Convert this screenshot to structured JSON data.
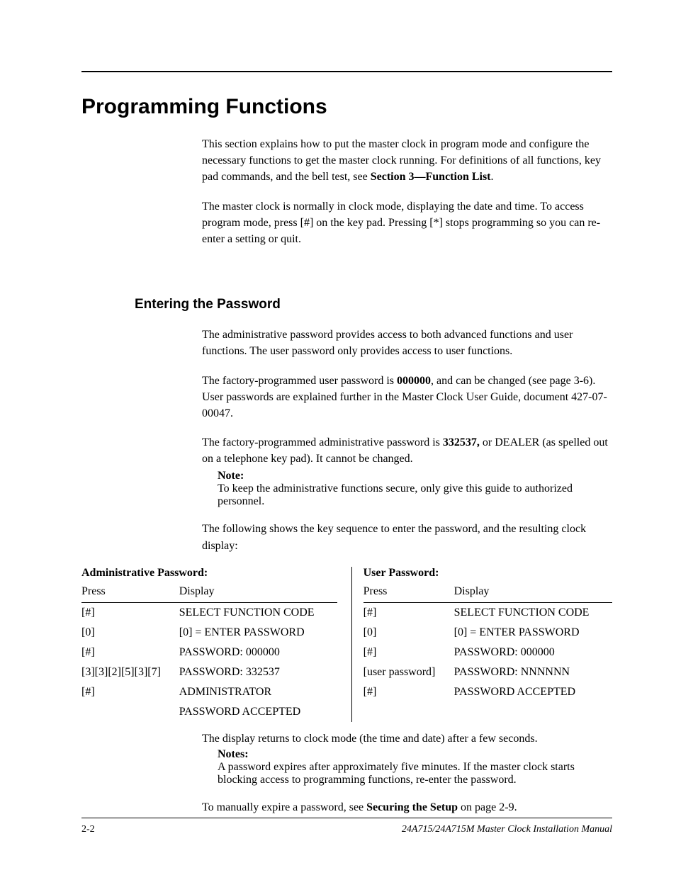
{
  "main_heading": "Programming Functions",
  "intro": {
    "p1a": "This section explains how to put the master clock in program mode and configure the necessary functions to get the master clock running. For definitions of all functions, key pad commands, and the bell test, see ",
    "p1bold": "Section 3—Function List",
    "p1b": ".",
    "p2": "The master clock is normally in clock mode, displaying the date and time. To access program mode, press [#] on the key pad. Pressing [*] stops programming so you can re-enter a setting or quit."
  },
  "sub_heading": "Entering the Password",
  "pw": {
    "p1": "The administrative password provides access to both advanced functions and user functions. The user password only provides access to user functions.",
    "p2a": "The factory-programmed user password is ",
    "p2bold": "000000",
    "p2b": ", and can be changed (see page 3-6). User passwords are explained further in the Master Clock User Guide, document 427-07-00047.",
    "p3a": "The factory-programmed administrative password is ",
    "p3bold": "332537,",
    "p3b": " or DEALER (as spelled out on a telephone key pad). It cannot be changed.",
    "note_label": "Note:",
    "note_text": "To keep the administrative functions secure, only give this guide to authorized personnel.",
    "p4": "The following shows the key sequence to enter the password, and the resulting clock display:"
  },
  "admin_title": "Administrative Password:",
  "user_title": "User Password:",
  "th_press": "Press",
  "th_display": "Display",
  "admin_rows": [
    {
      "press": "[#]",
      "disp": "SELECT FUNCTION CODE"
    },
    {
      "press": "[0]",
      "disp": "[0] = ENTER PASSWORD"
    },
    {
      "press": "[#]",
      "disp": "PASSWORD:   000000"
    },
    {
      "press": "[3][3][2][5][3][7]",
      "disp": "PASSWORD:   332537"
    },
    {
      "press": "[#]",
      "disp": "ADMINISTRATOR"
    },
    {
      "press": "",
      "disp": "PASSWORD ACCEPTED"
    }
  ],
  "user_rows": [
    {
      "press": "[#]",
      "disp": "SELECT FUNCTION CODE"
    },
    {
      "press": "[0]",
      "disp": "[0] = ENTER PASSWORD"
    },
    {
      "press": "[#]",
      "disp": "PASSWORD:   000000"
    },
    {
      "press": "[user password]",
      "disp": "PASSWORD:   NNNNNN"
    },
    {
      "press": "[#]",
      "disp": "PASSWORD ACCEPTED"
    }
  ],
  "after": {
    "p1": "The display returns to clock mode (the time and date) after a few seconds.",
    "notes_label": "Notes:",
    "notes_text": "A password expires after approximately five minutes. If the master clock starts blocking access to programming functions, re-enter the password.",
    "p2a": "To manually expire a password, see ",
    "p2bold": "Securing the Setup",
    "p2b": " on page 2-9."
  },
  "footer": {
    "left": "2-2",
    "right": "24A715/24A715M Master Clock Installation Manual"
  },
  "col_widths": {
    "admin_press": "140px",
    "admin_disp": "230px",
    "user_press": "130px",
    "user_disp": "230px"
  }
}
